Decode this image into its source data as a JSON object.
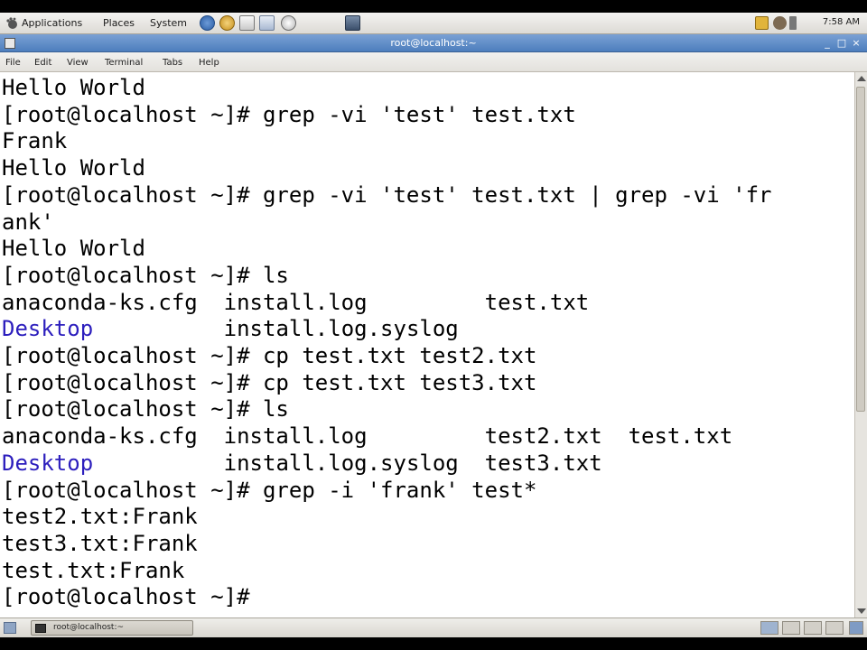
{
  "top_panel": {
    "menus": [
      "Applications",
      "Places",
      "System"
    ],
    "clock": "7:58 AM"
  },
  "window": {
    "title": "root@localhost:~",
    "menu": [
      "File",
      "Edit",
      "View",
      "Terminal",
      "Tabs",
      "Help"
    ]
  },
  "terminal": {
    "lines": [
      {
        "text": "Hello World",
        "kind": "output"
      },
      {
        "text": "[root@localhost ~]# grep -vi 'test' test.txt",
        "kind": "prompt"
      },
      {
        "text": "Frank",
        "kind": "output"
      },
      {
        "text": "Hello World",
        "kind": "output"
      },
      {
        "text": "[root@localhost ~]# grep -vi 'test' test.txt | grep -vi 'fr",
        "kind": "prompt"
      },
      {
        "text": "ank'",
        "kind": "output"
      },
      {
        "text": "Hello World",
        "kind": "output"
      },
      {
        "text": "[root@localhost ~]# ls",
        "kind": "prompt"
      },
      {
        "text": "anaconda-ks.cfg  install.log         test.txt",
        "kind": "output"
      },
      {
        "text": "Desktop          install.log.syslog",
        "kind": "dir",
        "dir": "Desktop",
        "rest": "          install.log.syslog"
      },
      {
        "text": "[root@localhost ~]# cp test.txt test2.txt",
        "kind": "prompt"
      },
      {
        "text": "[root@localhost ~]# cp test.txt test3.txt",
        "kind": "prompt"
      },
      {
        "text": "[root@localhost ~]# ls",
        "kind": "prompt"
      },
      {
        "text": "anaconda-ks.cfg  install.log         test2.txt  test.txt",
        "kind": "output"
      },
      {
        "text": "Desktop          install.log.syslog  test3.txt",
        "kind": "dir",
        "dir": "Desktop",
        "rest": "          install.log.syslog  test3.txt"
      },
      {
        "text": "[root@localhost ~]# grep -i 'frank' test*",
        "kind": "prompt"
      },
      {
        "text": "test2.txt:Frank",
        "kind": "output"
      },
      {
        "text": "test3.txt:Frank",
        "kind": "output"
      },
      {
        "text": "test.txt:Frank",
        "kind": "output"
      },
      {
        "text": "[root@localhost ~]# ",
        "kind": "prompt"
      }
    ]
  },
  "taskbar": {
    "task_label": "root@localhost:~"
  },
  "colors": {
    "directory": "#2c1ebd",
    "titlebar": "#5a88c6"
  }
}
